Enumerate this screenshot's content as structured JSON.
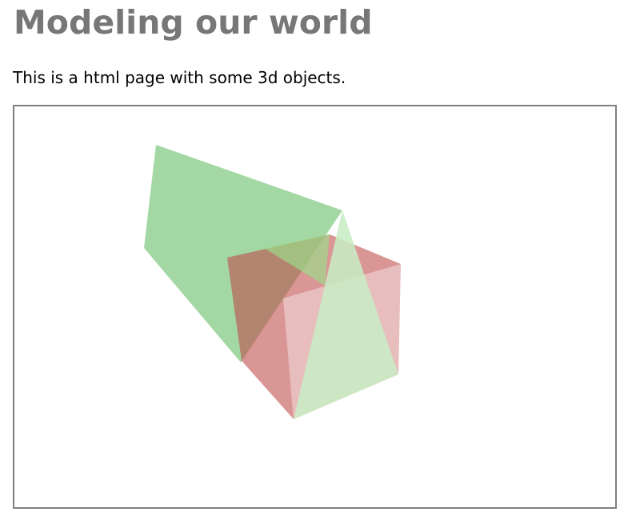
{
  "page": {
    "title": "Modeling our world",
    "intro": "This is a html page with some 3d objects."
  },
  "scene": {
    "background": "#ffffff",
    "border_color": "#808080",
    "objects": [
      {
        "name": "pyramid",
        "color": "#6fc06f"
      },
      {
        "name": "cube",
        "color": "#c04848"
      }
    ]
  }
}
